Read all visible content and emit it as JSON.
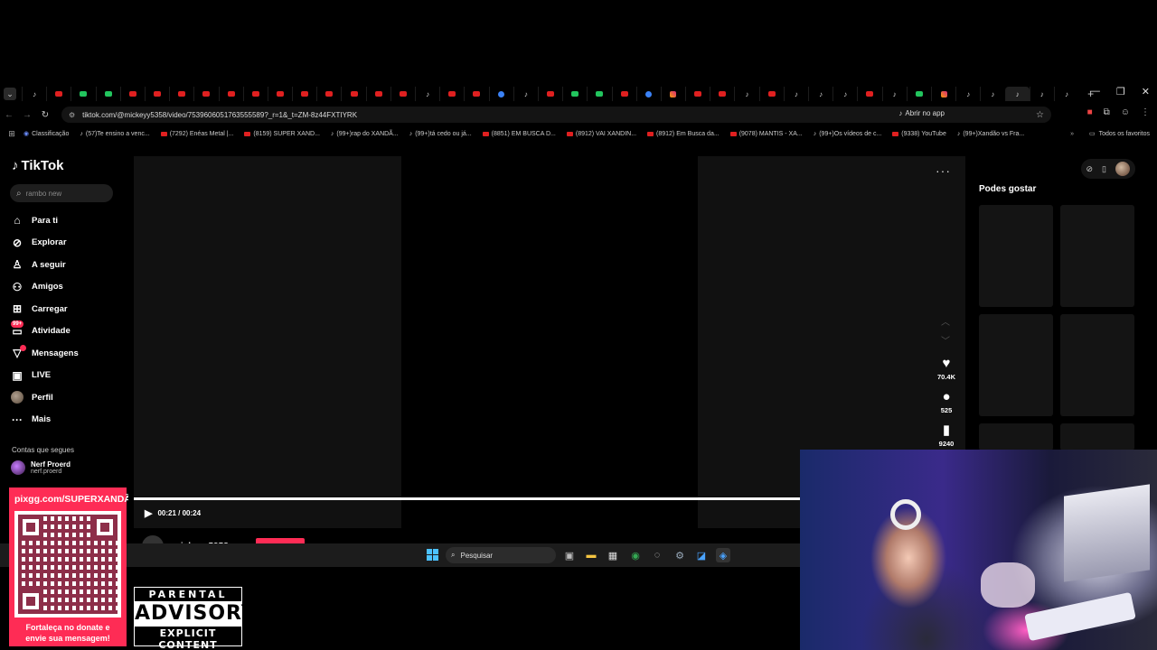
{
  "browser": {
    "tab_icons": [
      "tt",
      "yt",
      "gr",
      "gr",
      "yt",
      "yt",
      "yt",
      "yt",
      "yt",
      "yt",
      "yt",
      "yt",
      "yt",
      "yt",
      "yt",
      "yt",
      "tt",
      "yt",
      "yt",
      "bl",
      "tt",
      "yt",
      "gr",
      "gr",
      "yt",
      "bl",
      "ig",
      "yt",
      "yt",
      "tt",
      "yt",
      "tt",
      "tt",
      "tt",
      "yt",
      "tt",
      "gr",
      "ig",
      "tt",
      "tt",
      "tt",
      "tt",
      "tt"
    ],
    "new_tab": "+",
    "url": "tiktok.com/@mickeyy5358/video/7539606051763555589?_r=1&_t=ZM-8z44FXTIYRK",
    "open_in_app": "Abrir no app",
    "bookmarks": [
      {
        "icon": "bl",
        "label": "Classificação"
      },
      {
        "icon": "tt",
        "label": "(57)Te ensino a venc..."
      },
      {
        "icon": "yt",
        "label": "(7292) Enéas Metal |..."
      },
      {
        "icon": "yt",
        "label": "(8159) SUPER XAND..."
      },
      {
        "icon": "tt",
        "label": "(99+)rap do XANDÃ..."
      },
      {
        "icon": "tt",
        "label": "(99+)tá cedo ou já..."
      },
      {
        "icon": "yt",
        "label": "(8851) EM BUSCA D..."
      },
      {
        "icon": "yt",
        "label": "(8912) VAI XANDIN..."
      },
      {
        "icon": "yt",
        "label": "(8912) Em Busca da..."
      },
      {
        "icon": "yt",
        "label": "(9078) MANTIS - XA..."
      },
      {
        "icon": "tt",
        "label": "(99+)Os vídeos de c..."
      },
      {
        "icon": "yt",
        "label": "(9338) YouTube"
      },
      {
        "icon": "tt",
        "label": "(99+)Xandão vs Fra..."
      }
    ],
    "all_bookmarks": "Todos os favoritos"
  },
  "tiktok": {
    "logo": "TikTok",
    "search_placeholder": "rambo new",
    "nav": [
      {
        "icon": "⌂",
        "label": "Para ti",
        "badge": ""
      },
      {
        "icon": "⊘",
        "label": "Explorar",
        "badge": ""
      },
      {
        "icon": "♙",
        "label": "A seguir",
        "badge": ""
      },
      {
        "icon": "⚇",
        "label": "Amigos",
        "badge": ""
      },
      {
        "icon": "⊞",
        "label": "Carregar",
        "badge": ""
      },
      {
        "icon": "▭",
        "label": "Atividade",
        "badge": "99+"
      },
      {
        "icon": "▽",
        "label": "Mensagens",
        "badge": "•"
      },
      {
        "icon": "▣",
        "label": "LIVE",
        "badge": ""
      },
      {
        "icon": "avatar",
        "label": "Perfil",
        "badge": ""
      },
      {
        "icon": "···",
        "label": "Mais",
        "badge": ""
      }
    ],
    "following_title": "Contas que segues",
    "following": [
      {
        "name": "Nerf Proerd",
        "handle": "nerf.proerd"
      }
    ],
    "video": {
      "likes": "70.4K",
      "comments": "525",
      "saves": "9240",
      "time": "00:21 / 00:24",
      "progress": 1.0,
      "author": "mickeyy5358"
    },
    "suggest_title": "Podes gostar"
  },
  "taskbar": {
    "search_label": "Pesquisar"
  },
  "overlay": {
    "qr_url": "pixgg.com/SUPERXANDÃO",
    "qr_message_line1": "Fortaleça no donate e",
    "qr_message_line2": "envie sua mensagem!",
    "parental_line1": "PARENTAL",
    "parental_line2": "ADVISORY",
    "parental_line3": "EXPLICIT CONTENT"
  }
}
